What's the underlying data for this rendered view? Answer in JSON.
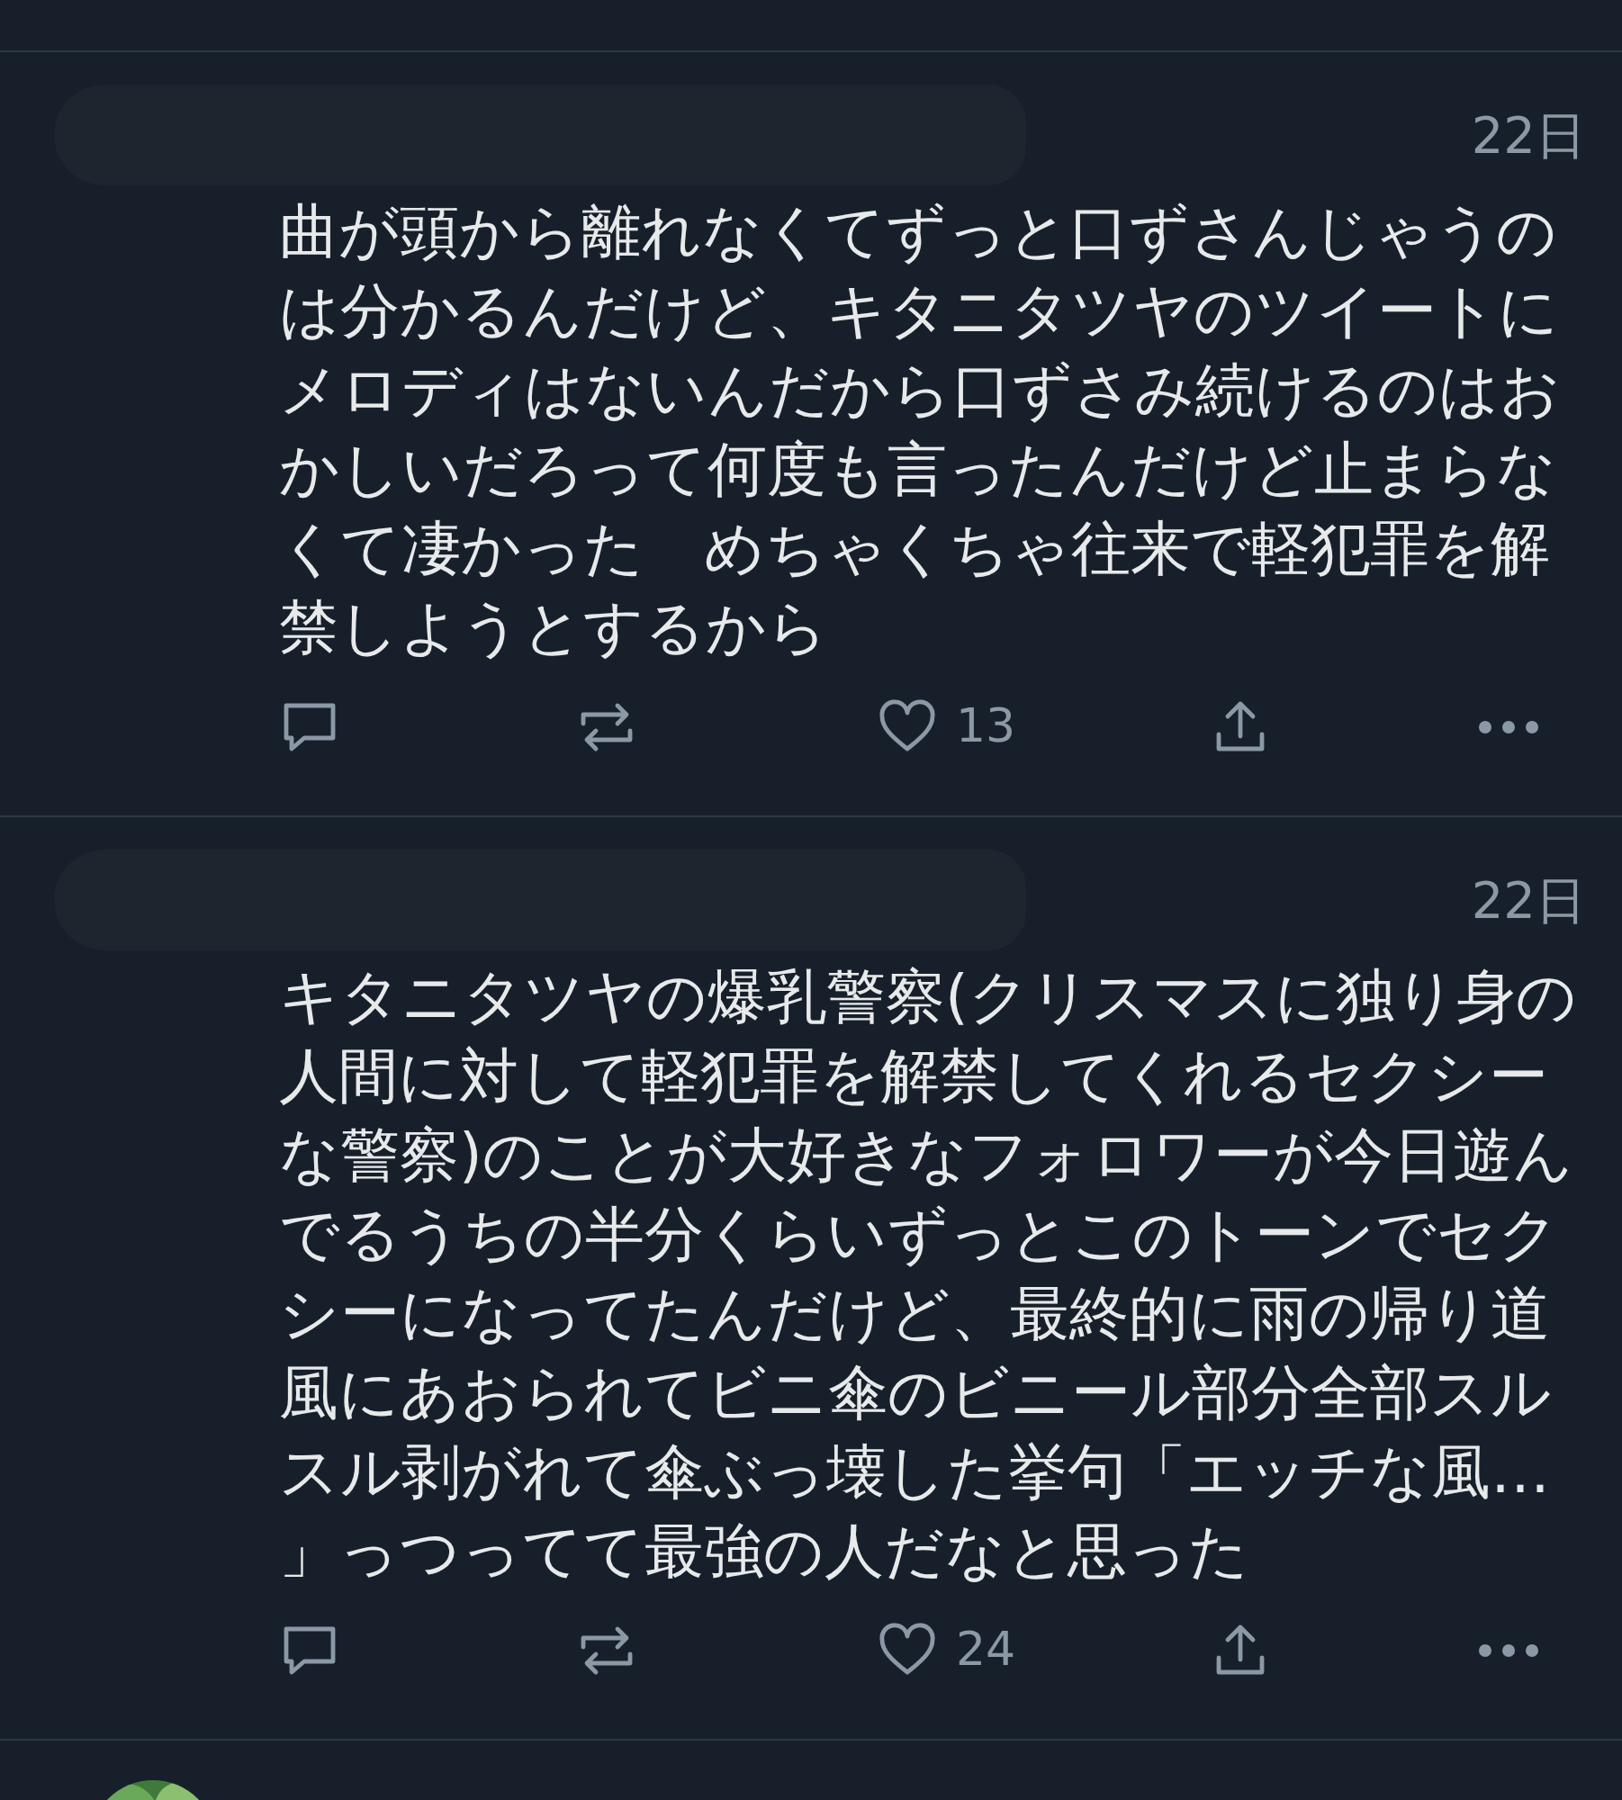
{
  "tweets": [
    {
      "date": "22日",
      "text": "曲が頭から離れなくてずっと口ずさんじゃうのは分かるんだけど、キタニタツヤのツイートにメロディはないんだから口ずさみ続けるのはおかしいだろって何度も言ったんだけど止まらなくて凄かった　めちゃくちゃ往来で軽犯罪を解禁しようとするから",
      "likes": "13"
    },
    {
      "date": "22日",
      "text": "キタニタツヤの爆乳警察(クリスマスに独り身の人間に対して軽犯罪を解禁してくれるセクシーな警察)のことが大好きなフォロワーが今日遊んでるうちの半分くらいずっとこのトーンでセクシーになってたんだけど、最終的に雨の帰り道風にあおられてビニ傘のビニール部分全部スルスル剥がれて傘ぶっ壊した挙句「エッチな風…」っつってて最強の人だなと思った",
      "likes": "24"
    }
  ]
}
